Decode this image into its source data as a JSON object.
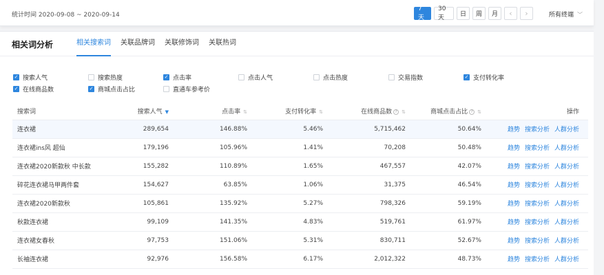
{
  "topbar": {
    "stat_time": "统计时间 2020-09-08 ~ 2020-09-14",
    "range_7": "7天",
    "range_30": "30天",
    "range_day": "日",
    "range_week": "周",
    "range_month": "月",
    "prev": "‹",
    "next": "›",
    "terminal": "所有终端"
  },
  "panel": {
    "title": "相关词分析",
    "tabs": [
      "相关搜索词",
      "关联品牌词",
      "关联修饰词",
      "关联热词"
    ]
  },
  "metrics": [
    {
      "label": "搜索人气",
      "checked": true
    },
    {
      "label": "搜索热度",
      "checked": false
    },
    {
      "label": "点击率",
      "checked": true
    },
    {
      "label": "点击人气",
      "checked": false
    },
    {
      "label": "点击热度",
      "checked": false
    },
    {
      "label": "交易指数",
      "checked": false
    },
    {
      "label": "支付转化率",
      "checked": true
    },
    {
      "label": "在线商品数",
      "checked": true
    },
    {
      "label": "商城点击占比",
      "checked": true
    },
    {
      "label": "直通车参考价",
      "checked": false
    }
  ],
  "table": {
    "headers": [
      "搜索词",
      "搜索人气",
      "点击率",
      "支付转化率",
      "在线商品数",
      "商城点击占比",
      "操作"
    ],
    "actions": [
      "趋势",
      "搜索分析",
      "人群分析"
    ],
    "rows": [
      [
        "连衣裙",
        "289,654",
        "146.88%",
        "5.46%",
        "5,715,462",
        "50.64%"
      ],
      [
        "连衣裙ins风 超仙",
        "179,196",
        "105.96%",
        "1.41%",
        "70,208",
        "50.48%"
      ],
      [
        "连衣裙2020新款秋 中长款",
        "155,282",
        "110.89%",
        "1.65%",
        "467,557",
        "42.07%"
      ],
      [
        "碎花连衣裙马甲两件套",
        "154,627",
        "63.85%",
        "1.06%",
        "31,375",
        "46.54%"
      ],
      [
        "连衣裙2020新款秋",
        "105,861",
        "135.92%",
        "5.27%",
        "798,326",
        "59.19%"
      ],
      [
        "秋款连衣裙",
        "99,109",
        "141.35%",
        "4.83%",
        "519,761",
        "61.97%"
      ],
      [
        "连衣裙女春秋",
        "97,753",
        "151.06%",
        "5.31%",
        "830,711",
        "52.67%"
      ],
      [
        "长袖连衣裙",
        "92,976",
        "156.58%",
        "6.17%",
        "2,012,322",
        "48.73%"
      ]
    ]
  }
}
